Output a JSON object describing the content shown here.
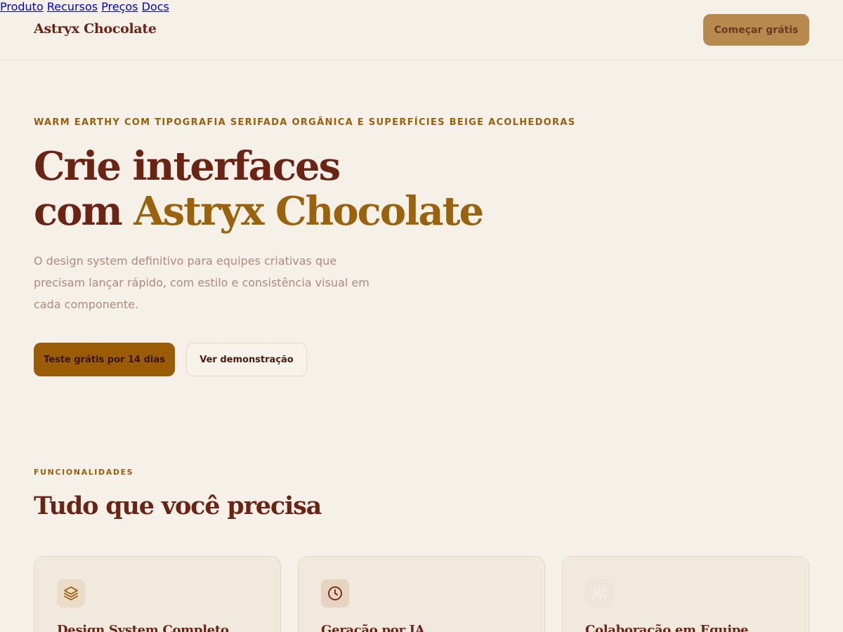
{
  "header": {
    "brand": "Astryx Chocolate",
    "nav": [
      {
        "label": "Produto"
      },
      {
        "label": "Recursos"
      },
      {
        "label": "Preços"
      },
      {
        "label": "Docs"
      }
    ],
    "cta_label": "Começar grátis"
  },
  "hero": {
    "eyebrow": "WARM EARTHY COM TIPOGRAFIA SERIFADA ORGÂNICA E SUPERFÍCIES BEIGE ACOLHEDORAS",
    "title_line1": "Crie interfaces",
    "title_line2_prefix": "com ",
    "title_accent": "Astryx Chocolate",
    "subtitle": "O design system definitivo para equipes criativas que precisam lançar rápido, com estilo e consistência visual em cada componente.",
    "primary_button": "Teste grátis por 14 dias",
    "secondary_button": "Ver demonstração"
  },
  "features": {
    "eyebrow": "FUNCIONALIDADES",
    "title": "Tudo que você precisa",
    "cards": [
      {
        "icon": "layers-icon",
        "title": "Design System Completo"
      },
      {
        "icon": "clock-icon",
        "title": "Geração por IA"
      },
      {
        "icon": "users-icon",
        "title": "Colaboração em Equipe"
      }
    ]
  },
  "colors": {
    "background": "#f5f0e8",
    "primary_text": "#6b2413",
    "accent": "#9a620a",
    "button_primary": "#9a5c05",
    "button_cta": "#b8894c",
    "card_bg": "#f1e8de"
  }
}
